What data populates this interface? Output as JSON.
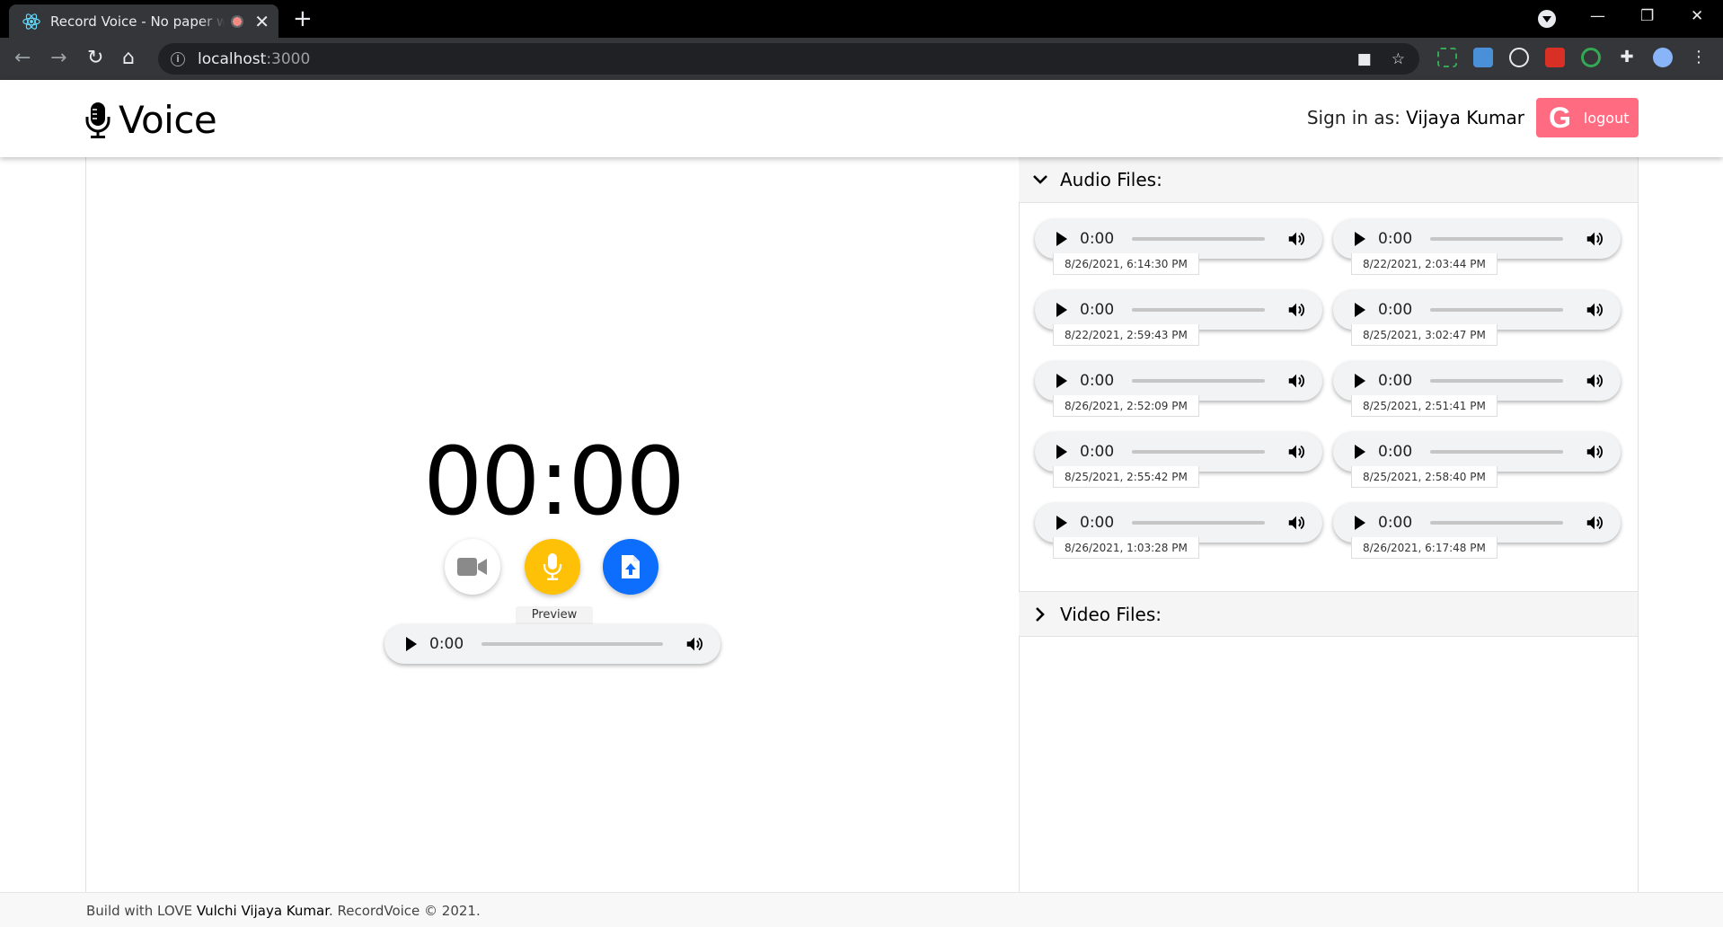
{
  "browser": {
    "tab_title": "Record Voice - No paper work",
    "url_host": "localhost",
    "url_port": ":3000"
  },
  "header": {
    "brand": "Voice",
    "signin_prefix": "Sign in as: ",
    "user_name": "Vijaya Kumar",
    "logout_letter": "G",
    "logout_label": "logout",
    "logout_color": "#ff6b81"
  },
  "recorder": {
    "timer": "00:00",
    "preview_label": "Preview",
    "preview_time": "0:00",
    "video_icon": "video-camera-icon",
    "mic_icon": "microphone-icon",
    "upload_icon": "file-upload-icon",
    "mic_color": "#ffc107",
    "upload_color": "#0d6efd"
  },
  "files": {
    "audio_title": "Audio Files:",
    "video_title": "Video Files:",
    "audio": [
      {
        "time": "0:00",
        "date": "8/26/2021, 6:14:30 PM"
      },
      {
        "time": "0:00",
        "date": "8/22/2021, 2:03:44 PM"
      },
      {
        "time": "0:00",
        "date": "8/22/2021, 2:59:43 PM"
      },
      {
        "time": "0:00",
        "date": "8/25/2021, 3:02:47 PM"
      },
      {
        "time": "0:00",
        "date": "8/26/2021, 2:52:09 PM"
      },
      {
        "time": "0:00",
        "date": "8/25/2021, 2:51:41 PM"
      },
      {
        "time": "0:00",
        "date": "8/25/2021, 2:55:42 PM"
      },
      {
        "time": "0:00",
        "date": "8/25/2021, 2:58:40 PM"
      },
      {
        "time": "0:00",
        "date": "8/26/2021, 1:03:28 PM"
      },
      {
        "time": "0:00",
        "date": "8/26/2021, 6:17:48 PM"
      }
    ]
  },
  "footer": {
    "prefix": "Build with LOVE ",
    "author": "Vulchi Vijaya Kumar",
    "suffix": ". RecordVoice © 2021."
  }
}
